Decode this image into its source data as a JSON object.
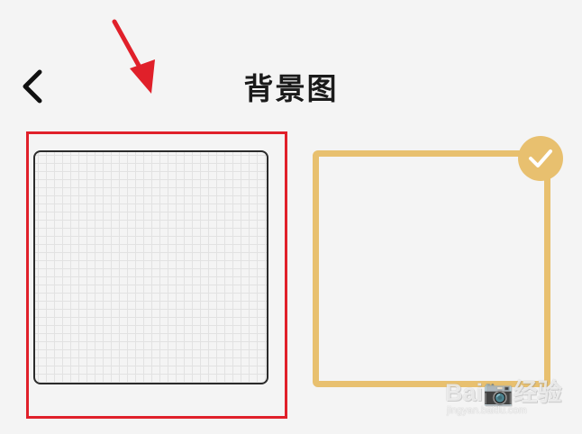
{
  "header": {
    "title": "背景图",
    "back_icon": "chevron-left-icon"
  },
  "backgrounds": [
    {
      "name": "grid",
      "selected": false,
      "highlighted": true
    },
    {
      "name": "blank",
      "selected": true,
      "highlighted": false
    }
  ],
  "selection_icon": "checkmark-icon",
  "annotation": {
    "arrow_icon": "red-arrow-icon"
  },
  "colors": {
    "accent": "#e8c06f",
    "highlight": "#e0202a",
    "background": "#f4f4f4",
    "text": "#1a1a1a"
  },
  "watermark": {
    "brand": "Bai📷经验",
    "url": "jingyan.baidu.com"
  }
}
